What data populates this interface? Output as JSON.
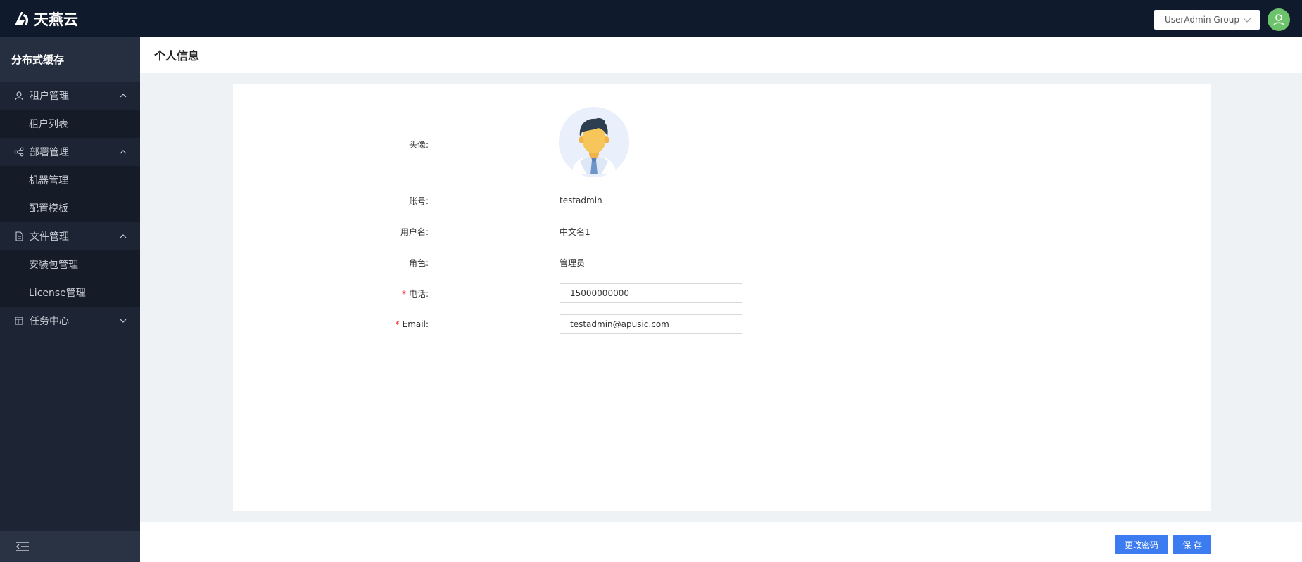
{
  "app": {
    "logo_text": "天燕云",
    "group_selector": "UserAdmin Group"
  },
  "sidebar": {
    "title": "分布式缓存",
    "groups": [
      {
        "label": "租户管理",
        "icon": "user-icon",
        "expanded": true,
        "items": [
          "租户列表"
        ]
      },
      {
        "label": "部署管理",
        "icon": "share-icon",
        "expanded": true,
        "items": [
          "机器管理",
          "配置模板"
        ]
      },
      {
        "label": "文件管理",
        "icon": "file-icon",
        "expanded": true,
        "items": [
          "安装包管理",
          "License管理"
        ]
      },
      {
        "label": "任务中心",
        "icon": "calendar-icon",
        "expanded": false,
        "items": []
      }
    ]
  },
  "page": {
    "title": "个人信息"
  },
  "profile": {
    "avatar_label": "头像:",
    "account_label": "账号:",
    "account": "testadmin",
    "username_label": "用户名:",
    "username": "中文名1",
    "role_label": "角色:",
    "role": "管理员",
    "phone_label": "电话:",
    "phone": "15000000000",
    "email_label": "Email:",
    "email": "testadmin@apusic.com",
    "required_mark": "*"
  },
  "actions": {
    "change_password": "更改密码",
    "save": "保 存"
  },
  "colors": {
    "topbar": "#0f1b2d",
    "sidebar": "#1d2535",
    "primary": "#3c7cf0",
    "avatar_green": "#6cc36b",
    "required": "#f5222d"
  }
}
